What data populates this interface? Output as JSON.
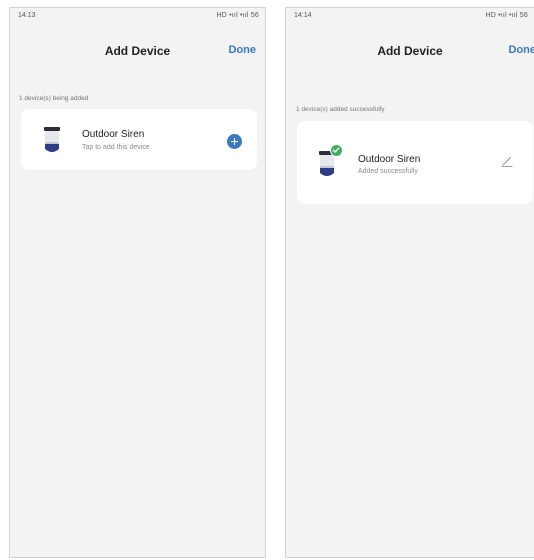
{
  "colors": {
    "accent": "#3a78c2",
    "success": "#3fae61",
    "background": "#f3f3f3",
    "card": "#ffffff"
  },
  "screens": [
    {
      "status_time": "14:13",
      "status_right": "HD •ııl •ııl 56",
      "title": "Add Device",
      "done_label": "Done",
      "section_label": "1 device(s) being added",
      "device": {
        "icon": "siren-icon",
        "name": "Outdoor Siren",
        "subtitle": "Tap to add this device",
        "action_icon": "plus-circle-icon"
      }
    },
    {
      "status_time": "14:14",
      "status_right": "HD •ııl •ııl 56",
      "title": "Add Device",
      "done_label": "Done",
      "section_label": "1 device(s) added successfully",
      "device": {
        "icon": "siren-icon",
        "name": "Outdoor Siren",
        "subtitle": "Added successfully",
        "badge_icon": "check-circle-icon",
        "action_icon": "pencil-edit-icon"
      }
    }
  ]
}
